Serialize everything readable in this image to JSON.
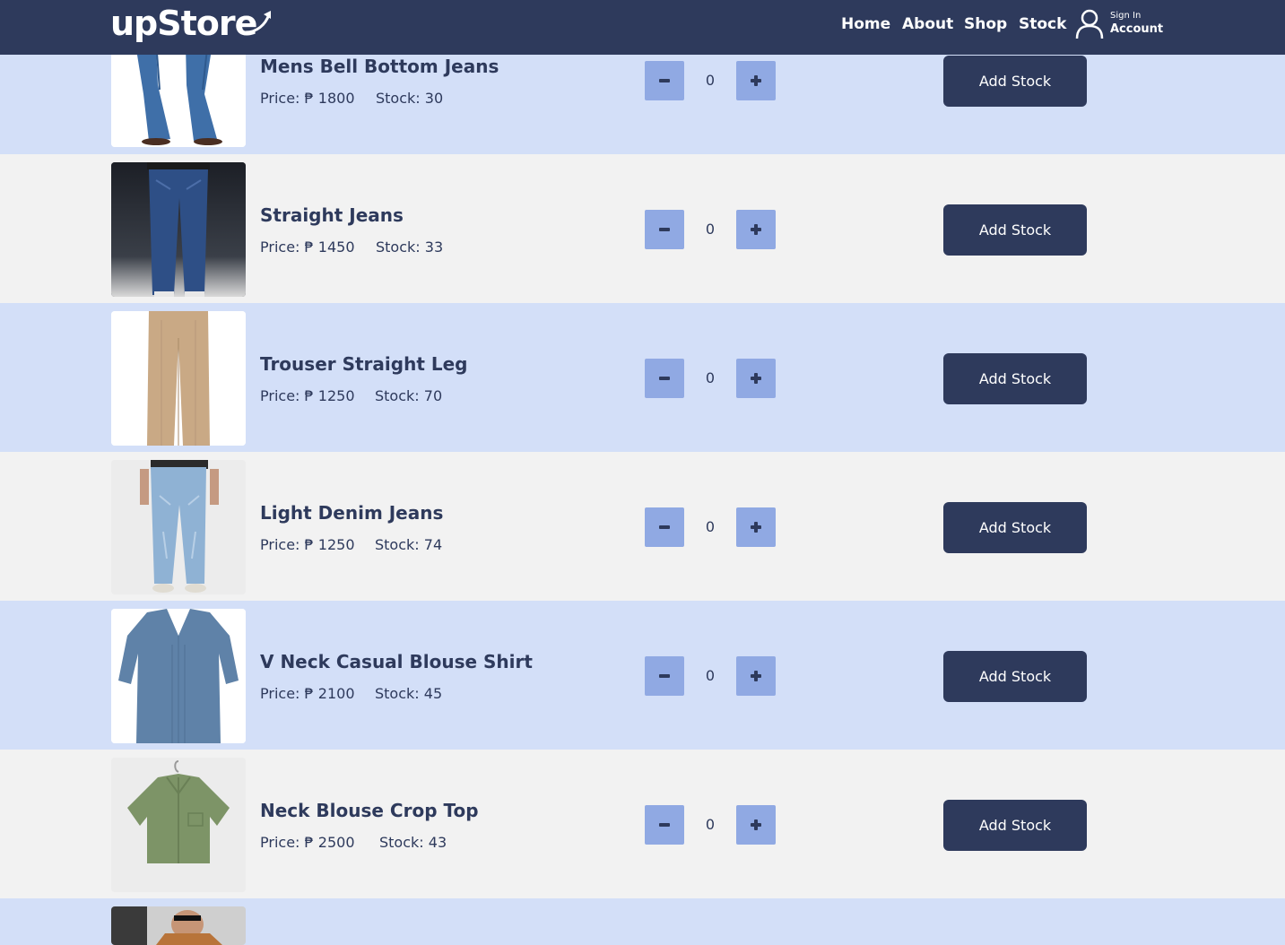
{
  "header": {
    "logo": "upStore",
    "nav": [
      "Home",
      "About",
      "Shop",
      "Stock"
    ],
    "sign_in": "Sign In",
    "account": "Account"
  },
  "products": [
    {
      "name": "Mens Bell Bottom Jeans",
      "price": "Price: ₱ 1800",
      "stock": "Stock: 30",
      "qty": "0",
      "button": "Add Stock"
    },
    {
      "name": "Straight Jeans",
      "price": "Price: ₱ 1450",
      "stock": "Stock: 33",
      "qty": "0",
      "button": "Add Stock"
    },
    {
      "name": "Trouser Straight Leg",
      "price": "Price: ₱ 1250",
      "stock": "Stock: 70",
      "qty": "0",
      "button": "Add Stock"
    },
    {
      "name": "Light Denim Jeans",
      "price": "Price: ₱ 1250",
      "stock": "Stock: 74",
      "qty": "0",
      "button": "Add Stock"
    },
    {
      "name": "V Neck Casual Blouse Shirt",
      "price": "Price: ₱ 2100",
      "stock": "Stock: 45",
      "qty": "0",
      "button": "Add Stock"
    },
    {
      "name": "Neck Blouse Crop Top",
      "price": "Price: ₱ 2500",
      "stock": "Stock: 43",
      "qty": "0",
      "button": "Add Stock"
    }
  ],
  "colors": {
    "header": "#2e3a5c",
    "row_alt": "#d3dff8",
    "row": "#f2f2f2",
    "qty_button": "#90a9e3",
    "add_button": "#2e3a5c"
  },
  "icons": [
    "account-icon",
    "minus-icon",
    "plus-icon"
  ]
}
